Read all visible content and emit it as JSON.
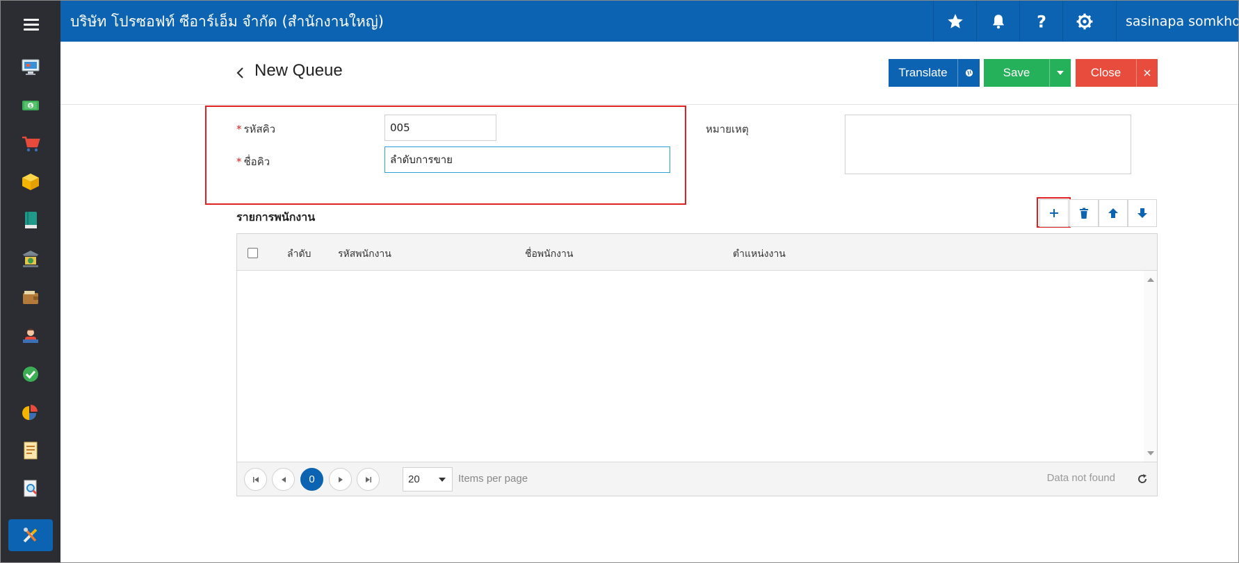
{
  "topbar": {
    "company": "บริษัท โปรซอฟท์ ซีอาร์เอ็ม จำกัด (สำนักงานใหญ่)",
    "user": "sasinapa somkho...",
    "icons": [
      "star-icon",
      "bell-icon",
      "help-icon",
      "gear-icon"
    ]
  },
  "sidebar": {
    "items": [
      "monitor-icon",
      "money-icon",
      "cart-icon",
      "box-icon",
      "book-icon",
      "bank-icon",
      "wallet-icon",
      "person-icon",
      "check-icon",
      "pie-chart-icon",
      "report-icon",
      "search-doc-icon",
      "tools-icon"
    ],
    "active": "tools-icon"
  },
  "page": {
    "title": "New Queue",
    "buttons": {
      "translate": "Translate",
      "save": "Save",
      "close": "Close"
    }
  },
  "form": {
    "code_label": "รหัสคิว",
    "code_value": "005",
    "name_label": "ชื่อคิว",
    "name_value": "ลำดับการขาย",
    "remark_label": "หมายเหตุ",
    "remark_value": "",
    "required_mark": "*"
  },
  "employees": {
    "section_title": "รายการพนักงาน",
    "columns": [
      "ลำดับ",
      "รหัสพนักงาน",
      "ชื่อพนักงาน",
      "ตำแหน่งงาน"
    ],
    "rows": [],
    "pager": {
      "current_page": "0",
      "page_size": "20",
      "items_per_page_label": "Items per page",
      "empty_text": "Data not found"
    }
  },
  "colors": {
    "primary": "#0b63b1",
    "sidebar": "#2b2d33",
    "success": "#25b05a",
    "danger": "#e74c3c",
    "highlight": "#e02020"
  }
}
